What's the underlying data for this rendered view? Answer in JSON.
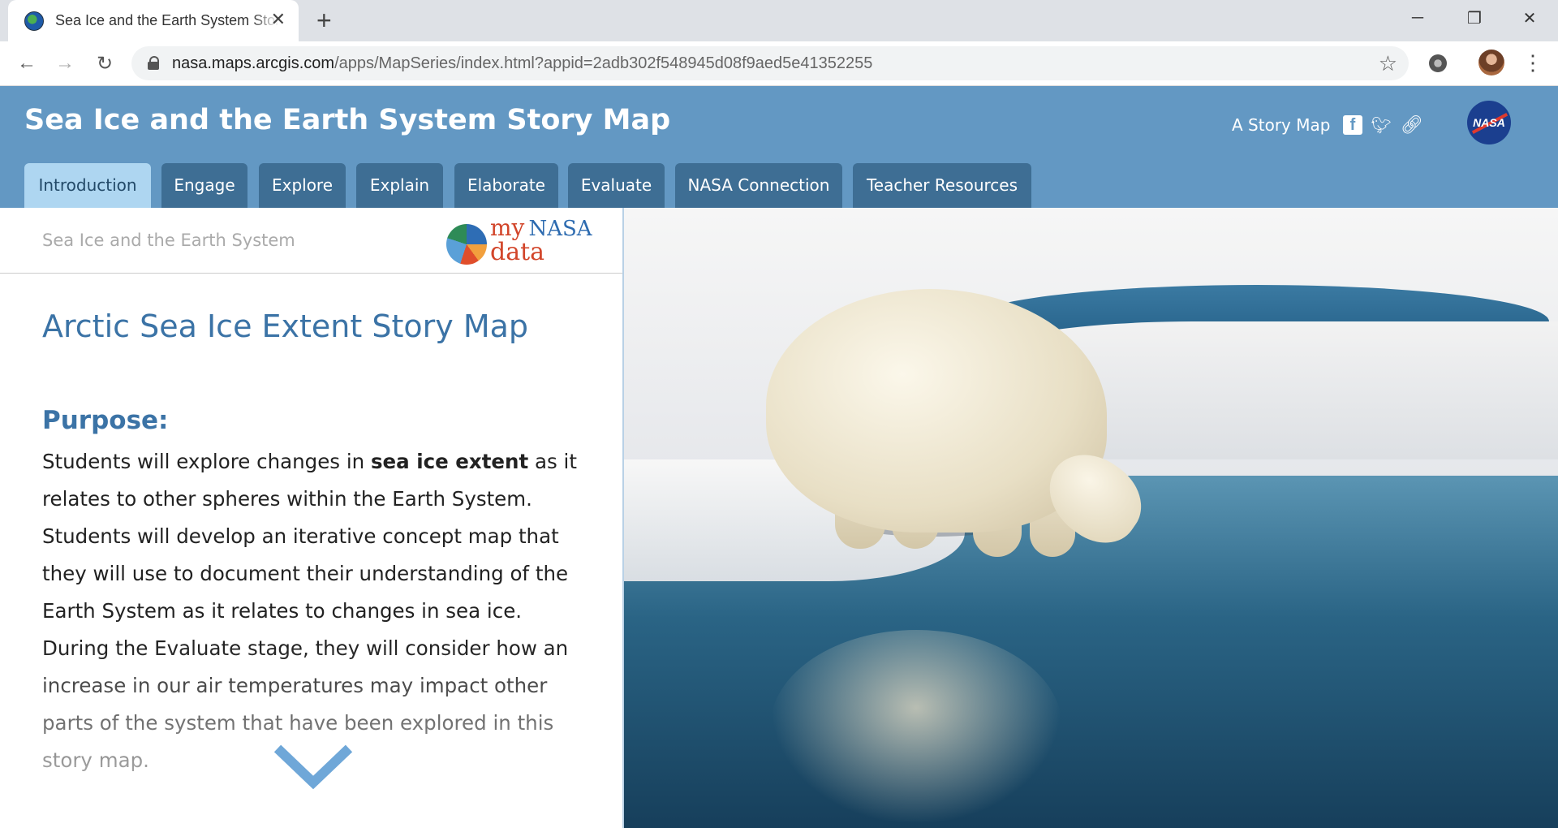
{
  "browser": {
    "tab_title": "Sea Ice and the Earth System Story Map",
    "tab_close": "✕",
    "new_tab": "+",
    "url_domain": "nasa.maps.arcgis.com",
    "url_rest": "/apps/MapSeries/index.html?appid=2adb302f548945d08f9aed5e41352255",
    "icons": [
      "back-icon",
      "forward-icon",
      "reload-icon",
      "lock-icon",
      "star-icon",
      "extension-icon",
      "profile-avatar",
      "menu-icon"
    ]
  },
  "header": {
    "title": "Sea Ice and the Earth System Story Map",
    "subtitle": "A Story Map",
    "logo_text": "NASA",
    "brand_color": "#6398c3",
    "tabs": [
      {
        "label": "Introduction",
        "active": true
      },
      {
        "label": "Engage"
      },
      {
        "label": "Explore"
      },
      {
        "label": "Explain"
      },
      {
        "label": "Elaborate"
      },
      {
        "label": "Evaluate"
      },
      {
        "label": "NASA Connection"
      },
      {
        "label": "Teacher Resources"
      }
    ]
  },
  "panel": {
    "header_title": "Sea Ice and the Earth System",
    "logo_my": "my",
    "logo_nasa": "NASA",
    "logo_data": "data",
    "heading": "Arctic Sea Ice Extent Story Map",
    "subheading": "Purpose:",
    "body_before": "Students will explore changes in ",
    "body_bold": "sea ice extent",
    "body_after": " as it relates to other spheres within the Earth System. Students will develop an iterative concept map that they will use to document their understanding of the Earth System as it relates to changes in sea ice. During the Evaluate stage, they will consider how an increase in our air temperatures may impact other parts of the system that have been explored in this story map."
  },
  "main_image": {
    "subject": "polar bear on sea ice"
  }
}
